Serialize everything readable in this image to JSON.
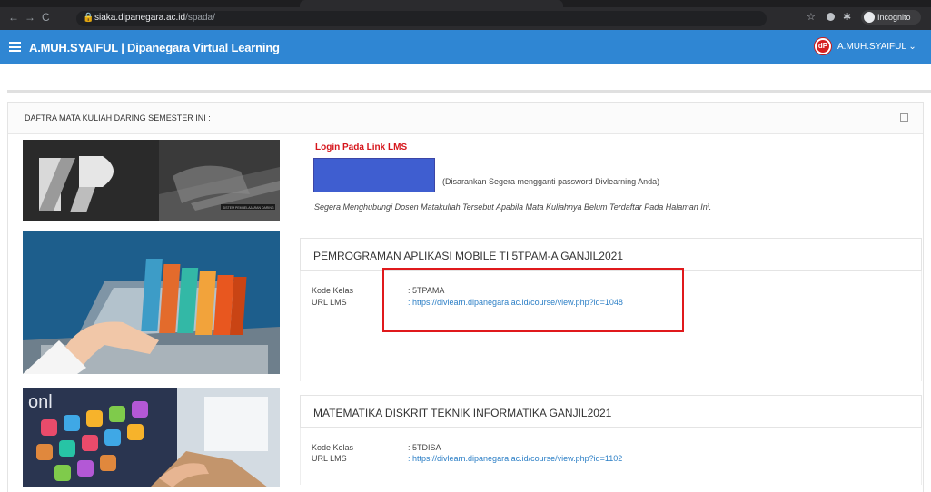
{
  "browser": {
    "url_host": "siaka.dipanegara.ac.id",
    "url_path": "/spada/",
    "incognito_label": "Incognito",
    "icons": [
      "back-icon",
      "forward-icon",
      "reload-icon",
      "lock-icon",
      "star-icon",
      "extension-icon",
      "puzzle-icon",
      "incognito-icon"
    ]
  },
  "header": {
    "title": "A.MUH.SYAIFUL | Dipanegara Virtual Learning",
    "user_name": "A.MUH.SYAIFUL",
    "user_logo_text": "dP",
    "colors": {
      "bar": "#2f86d3"
    }
  },
  "panel": {
    "title": "DAFTRA MATA KULIAH DARING SEMESTER INI :",
    "login": {
      "title": "Login Pada Link LMS",
      "advice": "(Disarankan Segera mengganti password Divlearning Anda)",
      "note": "Segera Menghubungi Dosen Matakuliah Tersebut Apabila Mata Kuliahnya Belum Terdaftar Pada Halaman Ini.",
      "banner_caption": "SISTEM PEMBELAJARAN DARING"
    },
    "courses": [
      {
        "name": "PEMROGRAMAN APLIKASI MOBILE TI 5TPAM-A GANJIL2021",
        "kode_label": "Kode Kelas",
        "kode_value": ": 5TPAMA",
        "url_label": "URL LMS",
        "url_value": ": https://divlearn.dipanegara.ac.id/course/view.php?id=1048"
      },
      {
        "name": "MATEMATIKA DISKRIT TEKNIK INFORMATIKA GANJIL2021",
        "kode_label": "Kode Kelas",
        "kode_value": ": 5TDISA",
        "url_label": "URL LMS",
        "url_value": ": https://divlearn.dipanegara.ac.id/course/view.php?id=1102"
      }
    ],
    "colors": {
      "login_title": "#d6161c",
      "link": "#2c7fc6",
      "highlight": "#e0191c"
    }
  }
}
